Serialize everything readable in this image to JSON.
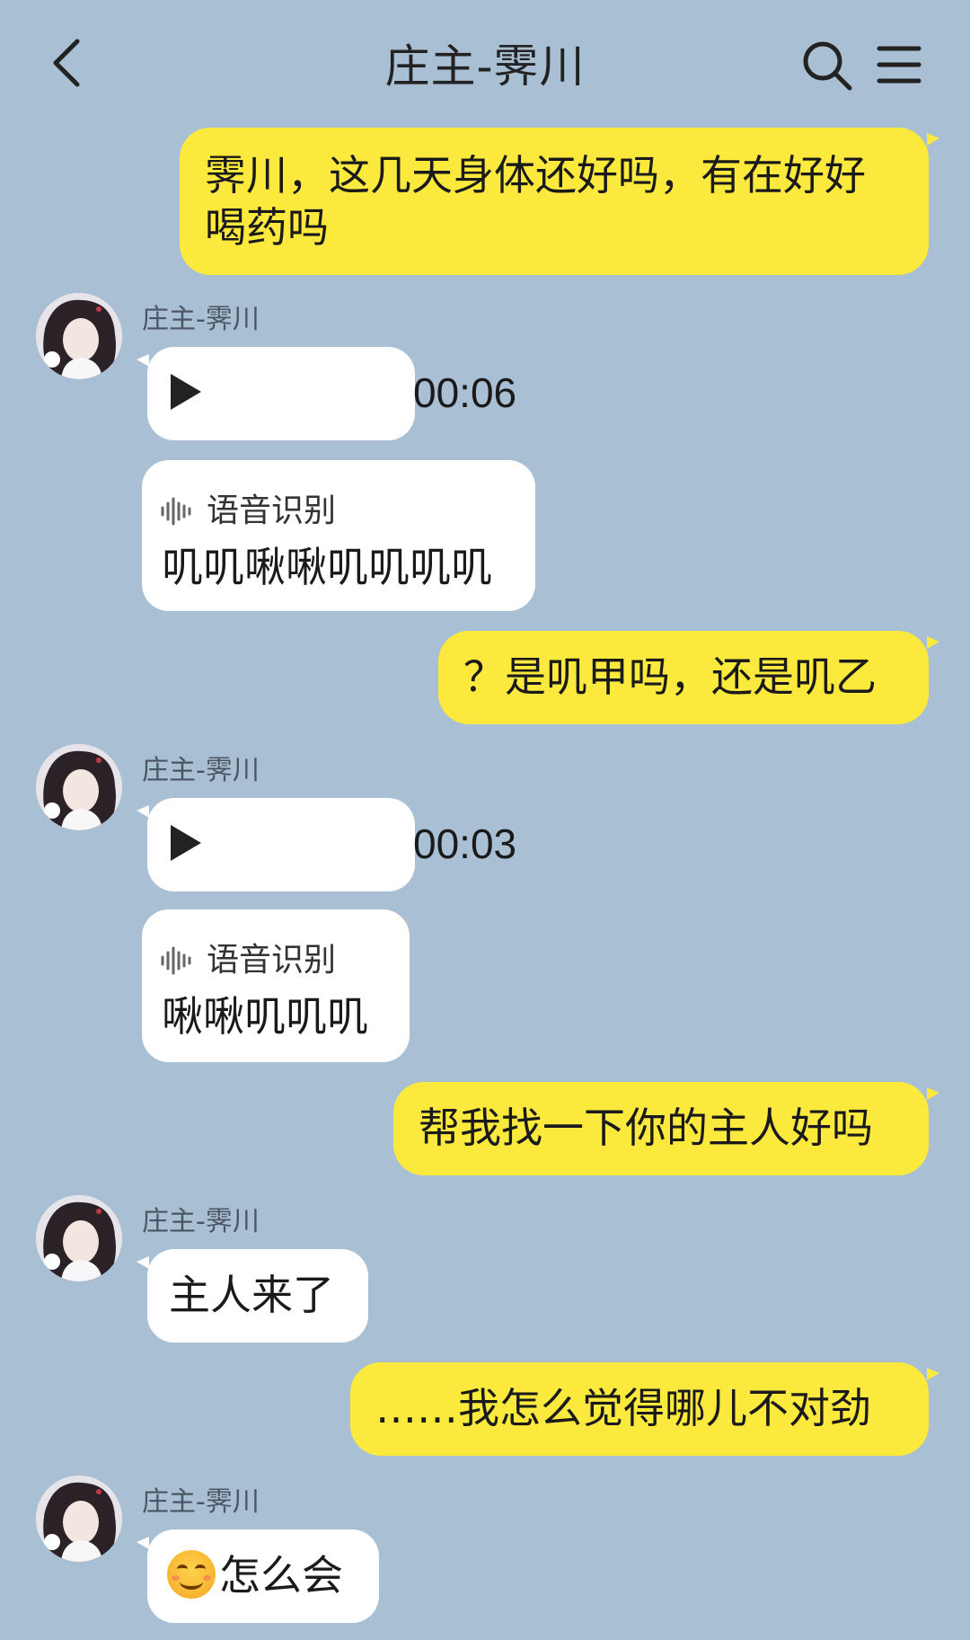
{
  "header": {
    "title": "庄主-霁川"
  },
  "messages": [
    {
      "type": "outgoing",
      "text": "霁川，这几天身体还好吗，有在好好喝药吗"
    },
    {
      "type": "incoming-voice",
      "sender": "庄主-霁川",
      "duration": "00:06"
    },
    {
      "type": "incoming-recognition",
      "label": "语音识别",
      "text": "叽叽啾啾叽叽叽叽"
    },
    {
      "type": "outgoing",
      "text": "？是叽甲吗，还是叽乙"
    },
    {
      "type": "incoming-voice",
      "sender": "庄主-霁川",
      "duration": "00:03"
    },
    {
      "type": "incoming-recognition",
      "label": "语音识别",
      "text": "啾啾叽叽叽"
    },
    {
      "type": "outgoing",
      "text": "帮我找一下你的主人好吗"
    },
    {
      "type": "incoming-text",
      "sender": "庄主-霁川",
      "text": "主人来了"
    },
    {
      "type": "outgoing",
      "text": "……我怎么觉得哪儿不对劲"
    },
    {
      "type": "incoming-text",
      "sender": "庄主-霁川",
      "text": "怎么会",
      "emoji": "smiling-face-emoji"
    }
  ],
  "colors": {
    "background": "#a9bfd3",
    "outgoing_bubble": "#fbe93d",
    "incoming_bubble": "#ffffff"
  },
  "icons": [
    "back-icon",
    "search-icon",
    "menu-icon",
    "play-icon",
    "voice-wave-icon",
    "avatar"
  ]
}
